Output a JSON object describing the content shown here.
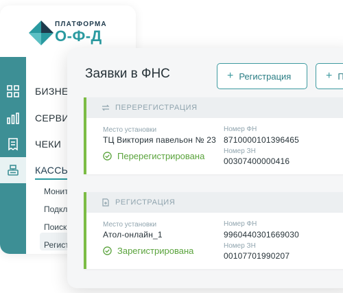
{
  "logo": {
    "top_text": "ПЛАТФОРМА",
    "main_text": "О-Ф-Д"
  },
  "sidebar": {
    "rail_icons": [
      "grid-icon",
      "chart-bars-icon",
      "receipt-icon",
      "cash-register-icon"
    ],
    "menu": [
      {
        "label": "БИЗНЕС"
      },
      {
        "label": "СЕРВИСЫ"
      },
      {
        "label": "ЧЕКИ"
      },
      {
        "label": "КАССЫ"
      }
    ],
    "submenu": [
      {
        "label": "Монит"
      },
      {
        "label": "Подкл"
      },
      {
        "label": "Поиск"
      },
      {
        "label": "Регист"
      }
    ]
  },
  "main": {
    "title": "Заявки в ФНС",
    "register_button": "Регистрация",
    "second_button": "П",
    "cards": [
      {
        "header": "ПЕРЕРЕГИСТРАЦИЯ",
        "header_icon": "swap-arrows-icon",
        "location_label": "Место установки",
        "location_value": "ТЦ Виктория павельон № 23",
        "status": "Перерегистрирована",
        "fn_label": "Номер ФН",
        "fn_value": "8710000101396465",
        "zn_label": "Номер ЗН",
        "zn_value": "00307400000416"
      },
      {
        "header": "РЕГИСТРАЦИЯ",
        "header_icon": "document-plus-icon",
        "location_label": "Место установки",
        "location_value": "Атол-онлайн_1",
        "status": "Зарегистрирована",
        "fn_label": "Номер ФН",
        "fn_value": "9960440301669030",
        "zn_label": "Номер ЗН",
        "zn_value": "00107701990207"
      }
    ]
  },
  "colors": {
    "teal": "#3d8f95",
    "accent": "#2a9aa0",
    "success": "#7cbc45",
    "text": "#263238"
  }
}
